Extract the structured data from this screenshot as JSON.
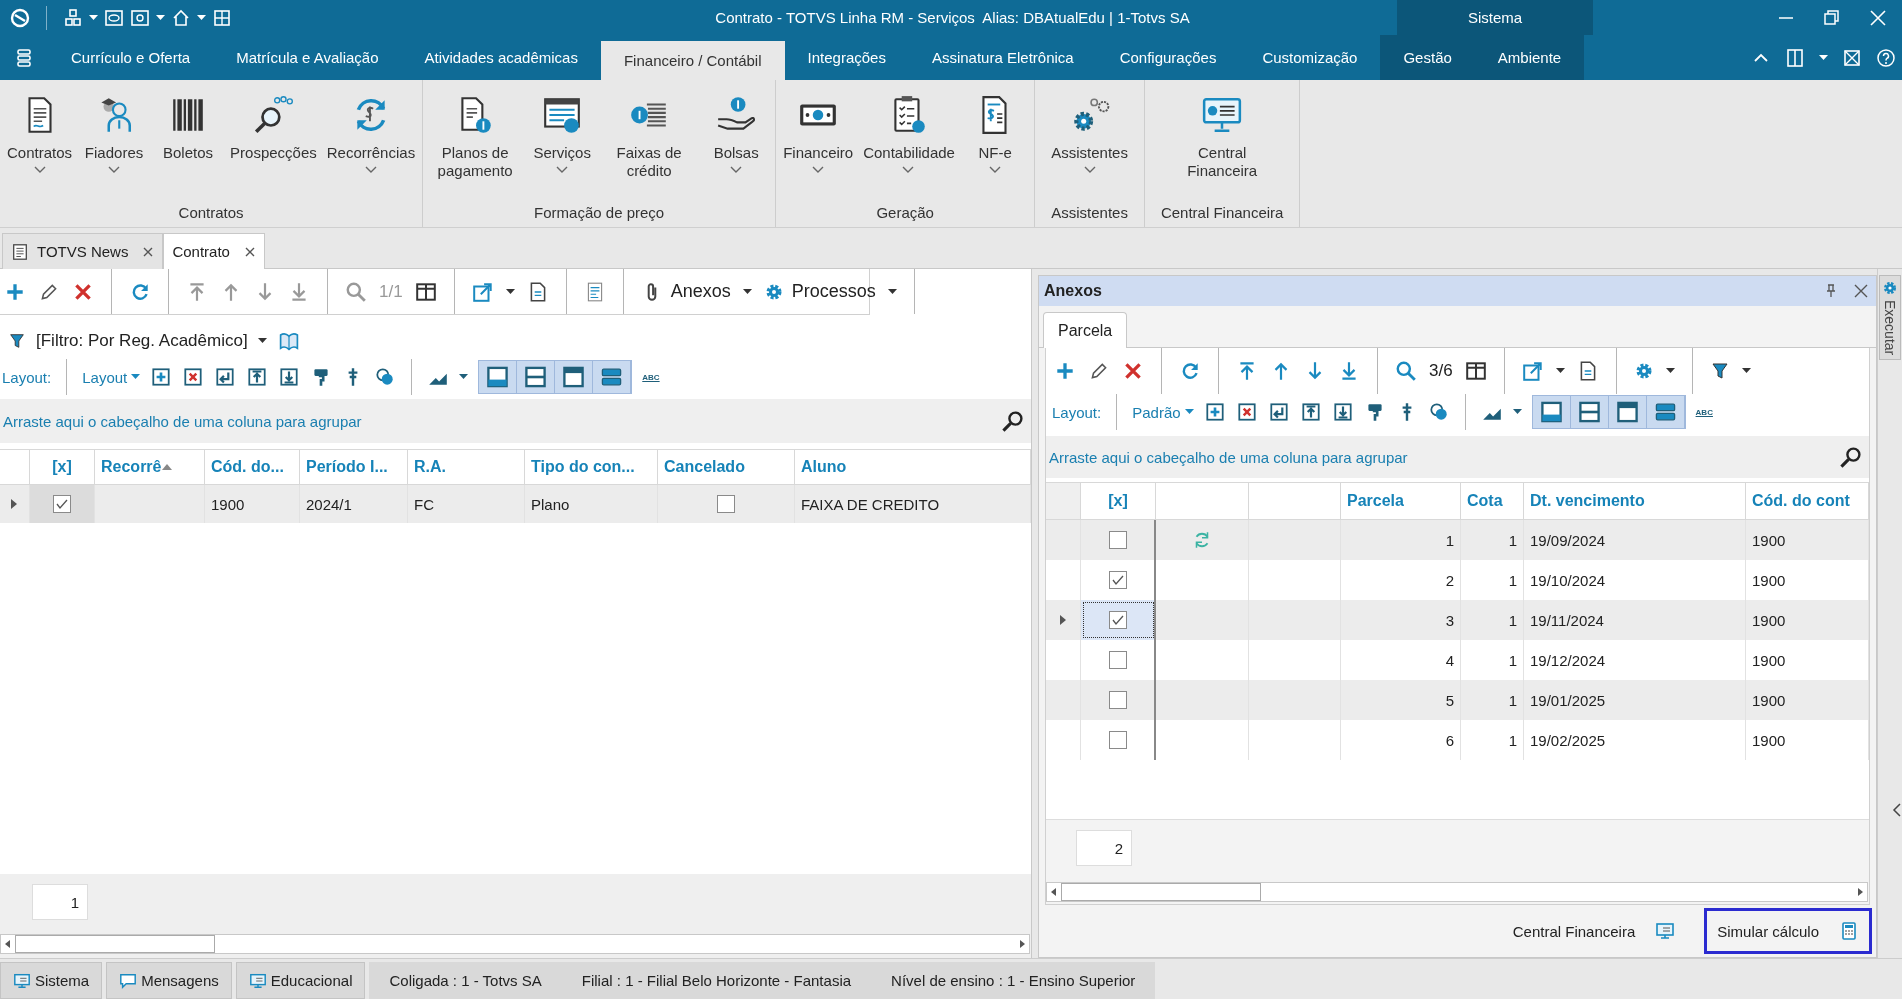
{
  "title_bar": {
    "title": "Contrato - TOTVS Linha RM - Serviços  Alias: DBAtualEdu | 1-Totvs SA",
    "context_label": "Sistema"
  },
  "ribbon": {
    "tabs": [
      {
        "label": "Currículo e Oferta",
        "selected": false,
        "context": false
      },
      {
        "label": "Matrícula e Avaliação",
        "selected": false,
        "context": false
      },
      {
        "label": "Atividades acadêmicas",
        "selected": false,
        "context": false
      },
      {
        "label": "Financeiro / Contábil",
        "selected": true,
        "context": false
      },
      {
        "label": "Integrações",
        "selected": false,
        "context": false
      },
      {
        "label": "Assinatura Eletrônica",
        "selected": false,
        "context": false
      },
      {
        "label": "Configurações",
        "selected": false,
        "context": false
      },
      {
        "label": "Customização",
        "selected": false,
        "context": false
      },
      {
        "label": "Gestão",
        "selected": false,
        "context": true
      },
      {
        "label": "Ambiente",
        "selected": false,
        "context": true
      }
    ],
    "groups": [
      {
        "label": "Contratos",
        "buttons": [
          {
            "label": "Contratos",
            "menu": true
          },
          {
            "label": "Fiadores",
            "menu": true
          },
          {
            "label": "Boletos",
            "menu": false
          },
          {
            "label": "Prospecções",
            "menu": false
          },
          {
            "label": "Recorrências",
            "menu": true
          }
        ]
      },
      {
        "label": "Formação de preço",
        "buttons": [
          {
            "label": "Planos de pagamento",
            "menu": false
          },
          {
            "label": "Serviços",
            "menu": true
          },
          {
            "label": "Faixas de crédito",
            "menu": false
          },
          {
            "label": "Bolsas",
            "menu": true
          }
        ]
      },
      {
        "label": "Geração",
        "buttons": [
          {
            "label": "Financeiro",
            "menu": true
          },
          {
            "label": "Contabilidade",
            "menu": true
          },
          {
            "label": "NF-e",
            "menu": true
          }
        ]
      },
      {
        "label": "Assistentes",
        "buttons": [
          {
            "label": "Assistentes",
            "menu": true
          }
        ]
      },
      {
        "label": "Central Financeira",
        "buttons": [
          {
            "label": "Central Financeira",
            "menu": false
          }
        ]
      }
    ]
  },
  "doc_tabs": [
    {
      "label": "TOTVS News",
      "selected": false
    },
    {
      "label": "Contrato",
      "selected": true
    }
  ],
  "contract_panel": {
    "record_counter": "1/1",
    "menus": [
      "Anexos",
      "Processos"
    ],
    "filter": "[Filtro: Por Reg. Acadêmico]",
    "layout_label": "Layout:",
    "layout_menu": "Layout",
    "spellcheck_label": "ABC",
    "group_hint": "Arraste aqui o cabeçalho de uma coluna para agrupar",
    "columns": [
      {
        "label": "[x]",
        "sorted": false
      },
      {
        "label": "Recorrê",
        "sorted": true
      },
      {
        "label": "Cód. do...",
        "sorted": false
      },
      {
        "label": "Período I...",
        "sorted": false
      },
      {
        "label": "R.A.",
        "sorted": false
      },
      {
        "label": "Tipo do con...",
        "sorted": false
      },
      {
        "label": "Cancelado",
        "sorted": false
      },
      {
        "label": "Aluno",
        "sorted": false
      }
    ],
    "rows": [
      {
        "selected": true,
        "checked": true,
        "codigo": "1900",
        "periodo": "2024/1",
        "ra": "FC",
        "tipo": "Plano",
        "cancelado": false,
        "aluno": "FAIXA DE CREDITO"
      }
    ],
    "record_count": "1"
  },
  "attachments_panel": {
    "title": "Anexos",
    "tabs": [
      {
        "label": "Parcela",
        "selected": true
      }
    ],
    "record_counter": "3/6",
    "layout_label": "Layout:",
    "layout_menu": "Padrão",
    "spellcheck_label": "ABC",
    "group_hint": "Arraste aqui o cabeçalho de uma coluna para agrupar",
    "columns": [
      "[x]",
      "Parcela",
      "Cota",
      "Dt. vencimento",
      "Cód. do cont"
    ],
    "rows": [
      {
        "selected": false,
        "checked": false,
        "recurring": true,
        "parcela": "1",
        "cota": "1",
        "vencimento": "19/09/2024",
        "contrato": "1900"
      },
      {
        "selected": false,
        "checked": true,
        "recurring": false,
        "parcela": "2",
        "cota": "1",
        "vencimento": "19/10/2024",
        "contrato": "1900"
      },
      {
        "selected": true,
        "checked": true,
        "recurring": false,
        "parcela": "3",
        "cota": "1",
        "vencimento": "19/11/2024",
        "contrato": "1900"
      },
      {
        "selected": false,
        "checked": false,
        "recurring": false,
        "parcela": "4",
        "cota": "1",
        "vencimento": "19/12/2024",
        "contrato": "1900"
      },
      {
        "selected": false,
        "checked": false,
        "recurring": false,
        "parcela": "5",
        "cota": "1",
        "vencimento": "19/01/2025",
        "contrato": "1900"
      },
      {
        "selected": false,
        "checked": false,
        "recurring": false,
        "parcela": "6",
        "cota": "1",
        "vencimento": "19/02/2025",
        "contrato": "1900"
      }
    ],
    "record_count": "2",
    "actions": [
      {
        "label": "Central Financeira",
        "highlighted": false
      },
      {
        "label": "Simular cálculo",
        "highlighted": true
      }
    ]
  },
  "side_tab": {
    "label": "Executar"
  },
  "status_bar": {
    "tabs": [
      "Sistema",
      "Mensagens",
      "Educacional"
    ],
    "fields": [
      "Coligada : 1 - Totvs SA",
      "Filial : 1 - Filial Belo Horizonte - Fantasia",
      "Nível de ensino : 1 - Ensino Superior"
    ]
  }
}
